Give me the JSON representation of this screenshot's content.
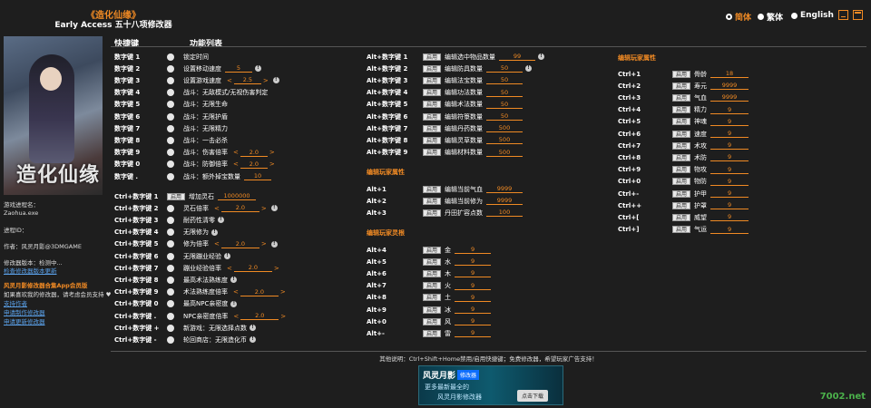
{
  "header": {
    "title": "《造化仙缘》",
    "subtitle": "Early Access 五十八项修改器"
  },
  "langs": [
    "简体",
    "繁体",
    "English"
  ],
  "side": {
    "proc_label": "游戏进程名：",
    "proc_value": "Zaohua.exe",
    "pid_label": "进程ID：",
    "author": "作者：风灵月影@3DMGAME",
    "version": "修改器版本：检测中...",
    "update": "检查修改器版本更新",
    "app": "风灵月影修改器合集App会员版",
    "support_text": "如果喜欢我的修改器，请考虑会员支持 ♥",
    "link1": "支持作者",
    "link2": "申请制作修改器",
    "link3": "申请更新修改器"
  },
  "cols": {
    "hotkey": "快捷键",
    "func": "功能列表"
  },
  "c1": [
    {
      "k": "数字键 1",
      "t": "锁定时间"
    },
    {
      "k": "数字键 2",
      "t": "设置移动速度",
      "v": "5",
      "i": "!"
    },
    {
      "k": "数字键 3",
      "t": "设置游戏速度",
      "v": "2.5",
      "a": true,
      "i": "!"
    },
    {
      "k": "数字键 4",
      "t": "战斗：无敌模式/无视伤害判定"
    },
    {
      "k": "数字键 5",
      "t": "战斗：无限生命"
    },
    {
      "k": "数字键 6",
      "t": "战斗：无限护盾"
    },
    {
      "k": "数字键 7",
      "t": "战斗：无限精力"
    },
    {
      "k": "数字键 8",
      "t": "战斗：一击必杀"
    },
    {
      "k": "数字键 9",
      "t": "战斗：伤害倍率",
      "v": "2.0",
      "a": true
    },
    {
      "k": "数字键 0",
      "t": "战斗：防御倍率",
      "v": "2.0",
      "a": true
    },
    {
      "k": "数字键 .",
      "t": "战斗：额外掉宝数量",
      "v": "10"
    }
  ],
  "c2": [
    {
      "k": "Ctrl+数字键 1",
      "t": "增加灵石",
      "v": "1000000",
      "b": "启用"
    },
    {
      "k": "Ctrl+数字键 2",
      "t": "灵石倍率",
      "v": "2.0",
      "a": true,
      "i": "!"
    },
    {
      "k": "Ctrl+数字键 3",
      "t": "耐药性清零",
      "i": "!"
    },
    {
      "k": "Ctrl+数字键 4",
      "t": "无限修为",
      "i": "!"
    },
    {
      "k": "Ctrl+数字键 5",
      "t": "修为倍率",
      "v": "2.0",
      "a": true,
      "i": "!"
    },
    {
      "k": "Ctrl+数字键 6",
      "t": "无限蹦业经验",
      "i": "!"
    },
    {
      "k": "Ctrl+数字键 7",
      "t": "蹦业经验倍率",
      "v": "2.0",
      "a": true
    },
    {
      "k": "Ctrl+数字键 8",
      "t": "最高术法熟练度",
      "i": "!"
    },
    {
      "k": "Ctrl+数字键 9",
      "t": "术法熟练度倍率",
      "v": "2.0",
      "a": true
    },
    {
      "k": "Ctrl+数字键 0",
      "t": "最高NPC亲密度",
      "i": "!"
    },
    {
      "k": "Ctrl+数字键 .",
      "t": "NPC亲密度倍率",
      "v": "2.0",
      "a": true
    },
    {
      "k": "Ctrl+数字键 +",
      "t": "新游戏：无限选择点数",
      "i": "!"
    },
    {
      "k": "Ctrl+数字键 -",
      "t": "轮回商店：无限造化币",
      "i": "!"
    }
  ],
  "c3": [
    {
      "k": "Alt+数字键 1",
      "t": "编辑选中物品数量",
      "v": "99",
      "i": "!"
    },
    {
      "k": "Alt+数字键 2",
      "t": "编辑防具数量",
      "v": "50",
      "i": "!"
    },
    {
      "k": "Alt+数字键 3",
      "t": "编辑法宝数量",
      "v": "50"
    },
    {
      "k": "Alt+数字键 4",
      "t": "编辑功法数量",
      "v": "50"
    },
    {
      "k": "Alt+数字键 5",
      "t": "编辑术法数量",
      "v": "50"
    },
    {
      "k": "Alt+数字键 6",
      "t": "编辑符箓数量",
      "v": "50"
    },
    {
      "k": "Alt+数字键 7",
      "t": "编辑丹药数量",
      "v": "500"
    },
    {
      "k": "Alt+数字键 8",
      "t": "编辑灵草数量",
      "v": "500"
    },
    {
      "k": "Alt+数字键 9",
      "t": "编辑材料数量",
      "v": "500"
    }
  ],
  "s3b": "编辑玩家属性",
  "c3b": [
    {
      "k": "Alt+1",
      "t": "编辑当前气血",
      "v": "9999"
    },
    {
      "k": "Alt+2",
      "t": "编辑当前修为",
      "v": "9999"
    },
    {
      "k": "Alt+3",
      "t": "丹田扩容点数",
      "v": "100"
    }
  ],
  "s3c": "编辑玩家灵根",
  "c3c": [
    {
      "k": "Alt+4",
      "t": "金",
      "v": "9"
    },
    {
      "k": "Alt+5",
      "t": "水",
      "v": "9"
    },
    {
      "k": "Alt+6",
      "t": "木",
      "v": "9"
    },
    {
      "k": "Alt+7",
      "t": "火",
      "v": "9"
    },
    {
      "k": "Alt+8",
      "t": "土",
      "v": "9"
    },
    {
      "k": "Alt+9",
      "t": "冰",
      "v": "9"
    },
    {
      "k": "Alt+0",
      "t": "风",
      "v": "9"
    },
    {
      "k": "Alt+-",
      "t": "雷",
      "v": "9"
    }
  ],
  "s4": "编辑玩家属性",
  "c4": [
    {
      "k": "Ctrl+1",
      "t": "骨龄",
      "v": "18"
    },
    {
      "k": "Ctrl+2",
      "t": "寿元",
      "v": "9999"
    },
    {
      "k": "Ctrl+3",
      "t": "气血",
      "v": "9999"
    },
    {
      "k": "Ctrl+4",
      "t": "精力",
      "v": "9"
    },
    {
      "k": "Ctrl+5",
      "t": "神魂",
      "v": "9"
    },
    {
      "k": "Ctrl+6",
      "t": "速度",
      "v": "9"
    },
    {
      "k": "Ctrl+7",
      "t": "术攻",
      "v": "9"
    },
    {
      "k": "Ctrl+8",
      "t": "术防",
      "v": "9"
    },
    {
      "k": "Ctrl+9",
      "t": "物攻",
      "v": "9"
    },
    {
      "k": "Ctrl+0",
      "t": "物防",
      "v": "9"
    },
    {
      "k": "Ctrl+-",
      "t": "护甲",
      "v": "9"
    },
    {
      "k": "Ctrl++",
      "t": "护罩",
      "v": "9"
    },
    {
      "k": "Ctrl+[",
      "t": "威望",
      "v": "9"
    },
    {
      "k": "Ctrl+]",
      "t": "气运",
      "v": "9"
    }
  ],
  "enable": "启用",
  "note": "其他说明：Ctrl+Shift+Home禁用/启用快捷键；免费修改器，希望玩家广告支持！",
  "ad": {
    "brand": "风灵月影",
    "tag": "修改器",
    "l1": "更多最新最全的",
    "l2": "风灵月影修改器",
    "dl": "点击下载"
  },
  "wm": "7002.net"
}
